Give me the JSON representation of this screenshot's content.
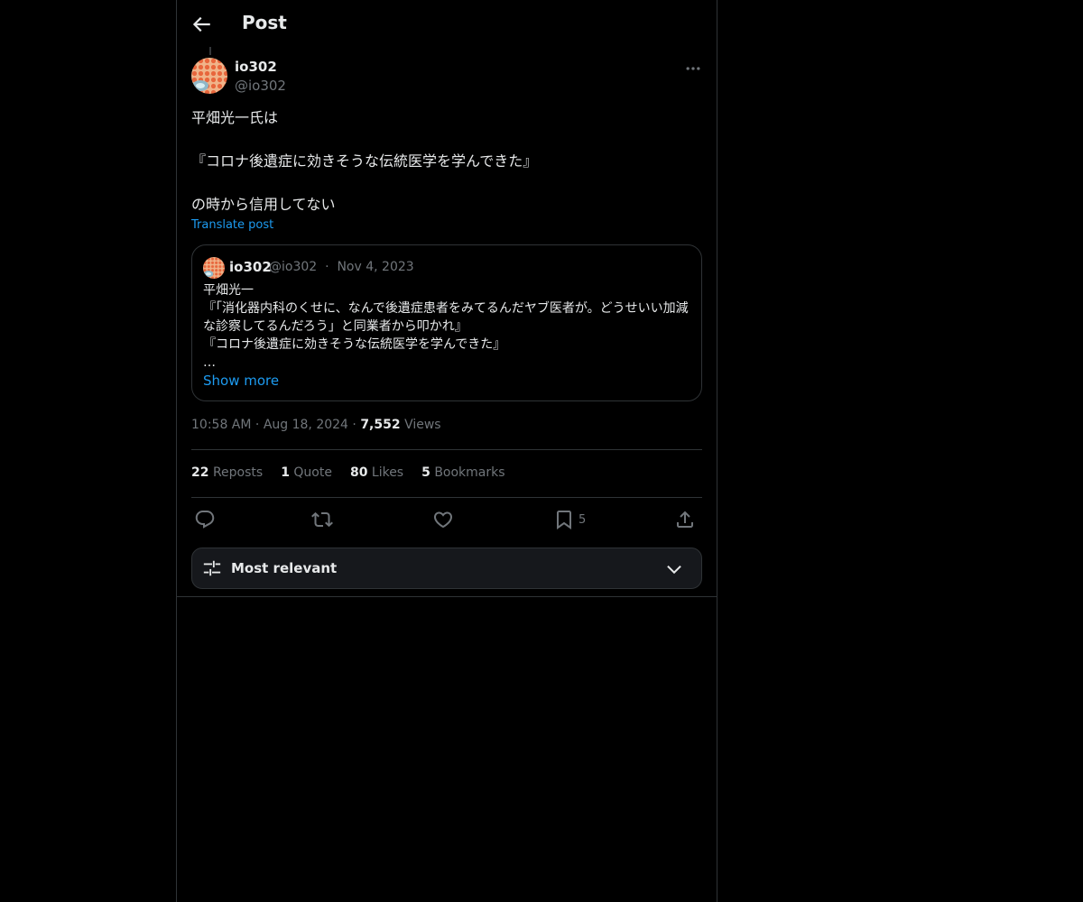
{
  "header": {
    "title": "Post"
  },
  "author": {
    "name": "io302",
    "handle": "@io302"
  },
  "post": {
    "text": "平畑光一氏は\n\n『コロナ後遺症に効きそうな伝統医学を学んできた』\n\nの時から信用してない",
    "translate_label": "Translate post"
  },
  "quote": {
    "name": "io302",
    "handle": "@io302",
    "separator": "·",
    "date": "Nov 4, 2023",
    "text": "平畑光一\n『「消化器内科のくせに、なんで後遺症患者をみてるんだヤブ医者が。どうせいい加減な診察してるんだろう」と同業者から叩かれ』\n『コロナ後遺症に効きそうな伝統医学を学んできた』\n…",
    "show_more": "Show more"
  },
  "meta": {
    "time": "10:58 AM",
    "separator": "·",
    "date": "Aug 18, 2024",
    "views_count": "7,552",
    "views_label": "Views"
  },
  "stats": [
    {
      "count": "22",
      "label": "Reposts"
    },
    {
      "count": "1",
      "label": "Quote"
    },
    {
      "count": "80",
      "label": "Likes"
    },
    {
      "count": "5",
      "label": "Bookmarks"
    }
  ],
  "actions": {
    "reply_icon": "reply-icon",
    "repost_icon": "repost-icon",
    "like_icon": "heart-icon",
    "bookmark_icon": "bookmark-icon",
    "bookmark_count": "5",
    "share_icon": "share-icon"
  },
  "sort": {
    "label": "Most relevant"
  },
  "colors": {
    "background": "#000000",
    "accent": "#1d9bf0",
    "muted": "#71767b",
    "text": "#e7e9ea",
    "border": "#2f3336"
  }
}
